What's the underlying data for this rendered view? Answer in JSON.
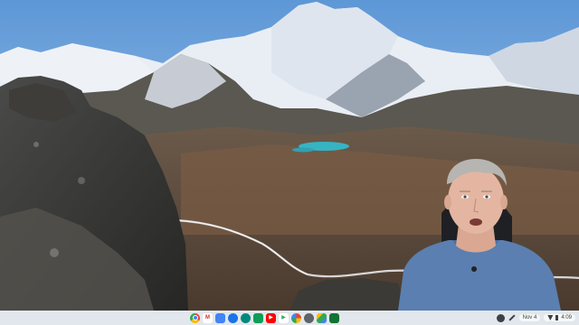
{
  "shelf": {
    "apps": [
      {
        "name": "chrome-icon",
        "glyph": "",
        "color": "#ea4335"
      },
      {
        "name": "gmail-icon",
        "glyph": "M",
        "color": "#d93025"
      },
      {
        "name": "docs-icon",
        "glyph": "",
        "color": "#4285f4"
      },
      {
        "name": "files-icon",
        "glyph": "",
        "color": "#1a73e8"
      },
      {
        "name": "meet-icon",
        "glyph": "",
        "color": "#00897b"
      },
      {
        "name": "sheets-icon",
        "glyph": "",
        "color": "#0f9d58"
      },
      {
        "name": "youtube-icon",
        "glyph": "▶",
        "color": "#ff0000"
      },
      {
        "name": "play-store-icon",
        "glyph": "▶",
        "color": "#34a853"
      },
      {
        "name": "photos-icon",
        "glyph": "",
        "color": "#fbbc04"
      },
      {
        "name": "settings-icon",
        "glyph": "",
        "color": "#5f6368"
      },
      {
        "name": "drive-icon",
        "glyph": "",
        "color": "#1e8e3e"
      },
      {
        "name": "camera-icon",
        "glyph": "",
        "color": "#137333"
      }
    ],
    "date": "Nov 4",
    "time": "4:09"
  }
}
